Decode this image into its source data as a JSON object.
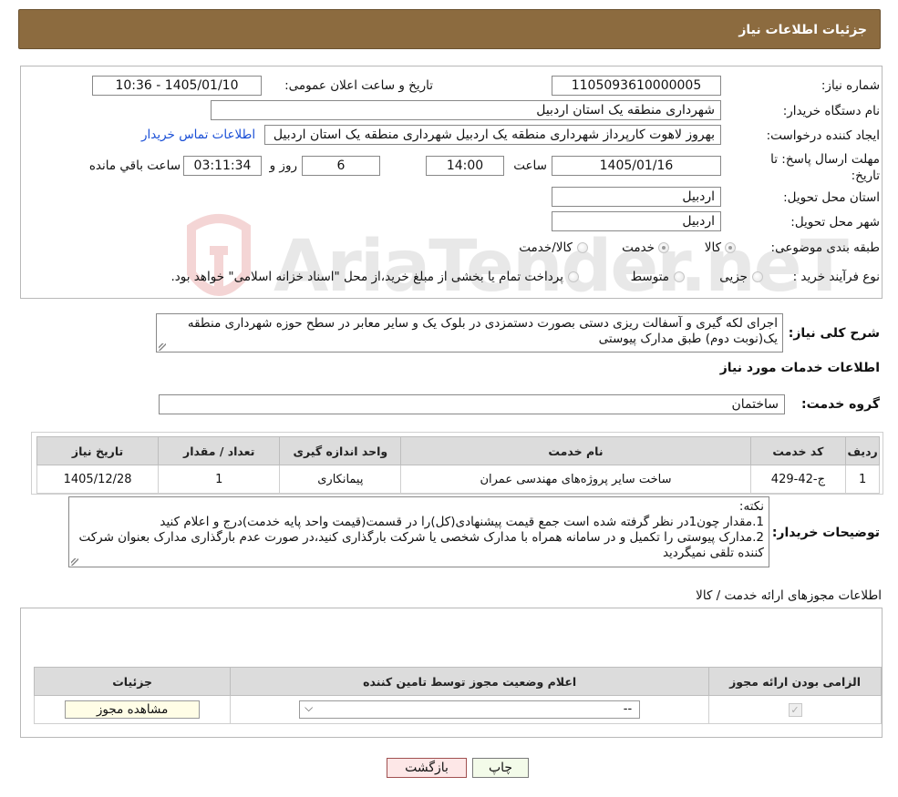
{
  "header": {
    "title": "جزئیات اطلاعات نیاز"
  },
  "form": {
    "need_number_label": "شماره نیاز:",
    "need_number": "1105093610000005",
    "announce_label": "تاریخ و ساعت اعلان عمومی:",
    "announce_value": "1405/01/10 - 10:36",
    "buyer_org_label": "نام دستگاه خریدار:",
    "buyer_org": "شهرداری منطقه یک استان اردبیل",
    "creator_label": "ایجاد کننده درخواست:",
    "creator": "بهروز لاهوت کارپرداز شهرداری منطقه یک اردبیل شهرداری منطقه یک استان اردبیل",
    "contact_link": "اطلاعات تماس خریدار",
    "deadline_label": "مهلت ارسال پاسخ: تا تاریخ:",
    "deadline_date": "1405/01/16",
    "time_label": "ساعت",
    "deadline_time": "14:00",
    "days_value": "6",
    "days_label": "روز و",
    "remaining_time": "03:11:34",
    "remaining_label": "ساعت باقي مانده",
    "province_label": "استان محل تحویل:",
    "province": "اردبیل",
    "city_label": "شهر محل تحویل:",
    "city": "اردبیل",
    "category_label": "طبقه بندی موضوعی:",
    "category_options": [
      "کالا",
      "خدمت",
      "کالا/خدمت"
    ],
    "purchase_type_label": "نوع فرآیند خرید :",
    "purchase_options": [
      "جزیی",
      "متوسط"
    ],
    "purchase_note": "پرداخت تمام یا بخشی از مبلغ خرید،از محل \"اسناد خزانه اسلامی\" خواهد بود."
  },
  "summary": {
    "label": "شرح کلی نیاز:",
    "text": "اجرای لکه گیری و آسفالت ریزی دستی بصورت دستمزدی در بلوک یک و سایر معابر در سطح حوزه شهرداری منطقه یک(نوبت دوم) طبق مدارک پیوستی"
  },
  "services": {
    "section_title": "اطلاعات خدمات مورد نیاز",
    "group_label": "گروه خدمت:",
    "group_value": "ساختمان",
    "columns": [
      "ردیف",
      "کد خدمت",
      "نام خدمت",
      "واحد اندازه گیری",
      "تعداد / مقدار",
      "تاریخ نیاز"
    ],
    "rows": [
      [
        "1",
        "ج-42-429",
        "ساخت سایر پروژه‌های مهندسی عمران",
        "پیمانکاری",
        "1",
        "1405/12/28"
      ]
    ]
  },
  "buyer_notes": {
    "label": "توضیحات خریدار:",
    "lines": [
      "نکته:",
      "1.مقدار چون1در نظر گرفته شده است جمع قیمت پیشنهادی(کل)را در قسمت(قیمت واحد پایه خدمت)درج و اعلام کنید",
      "2.مدارک پیوستی را تکمیل و در سامانه همراه با مدارک شخصی یا شرکت بارگذاری کنید،در صورت عدم بارگذاری مدارک بعنوان شرکت کننده تلقی نمیگردید"
    ]
  },
  "permits": {
    "section_title": "اطلاعات مجوزهای ارائه خدمت / کالا",
    "columns": [
      "الزامی بودن ارائه مجوز",
      "اعلام وضعیت مجوز توسط تامین کننده",
      "جزئیات"
    ],
    "select_value": "--",
    "view_button": "مشاهده مجوز"
  },
  "actions": {
    "print": "چاپ",
    "back": "بازگشت"
  },
  "watermark": {
    "text": "AriaTender.neT"
  }
}
